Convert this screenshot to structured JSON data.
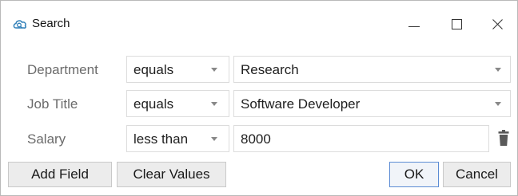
{
  "window": {
    "title": "Search",
    "icons": {
      "app": "cloud-search-icon",
      "minimize": "minimize-icon",
      "maximize": "maximize-icon",
      "close": "close-icon"
    }
  },
  "criteria": [
    {
      "field": "Department",
      "operator": "equals",
      "value": "Research",
      "value_type": "dropdown"
    },
    {
      "field": "Job Title",
      "operator": "equals",
      "value": "Software Developer",
      "value_type": "dropdown"
    },
    {
      "field": "Salary",
      "operator": "less than",
      "value": "8000",
      "value_type": "text",
      "action_icon": "trash-icon"
    }
  ],
  "buttons": {
    "add_field": "Add Field",
    "clear_values": "Clear Values",
    "ok": "OK",
    "cancel": "Cancel"
  },
  "colors": {
    "ok_border": "#5b8bd4",
    "button_bg": "#ececec",
    "label_text": "#6b6b6b"
  }
}
